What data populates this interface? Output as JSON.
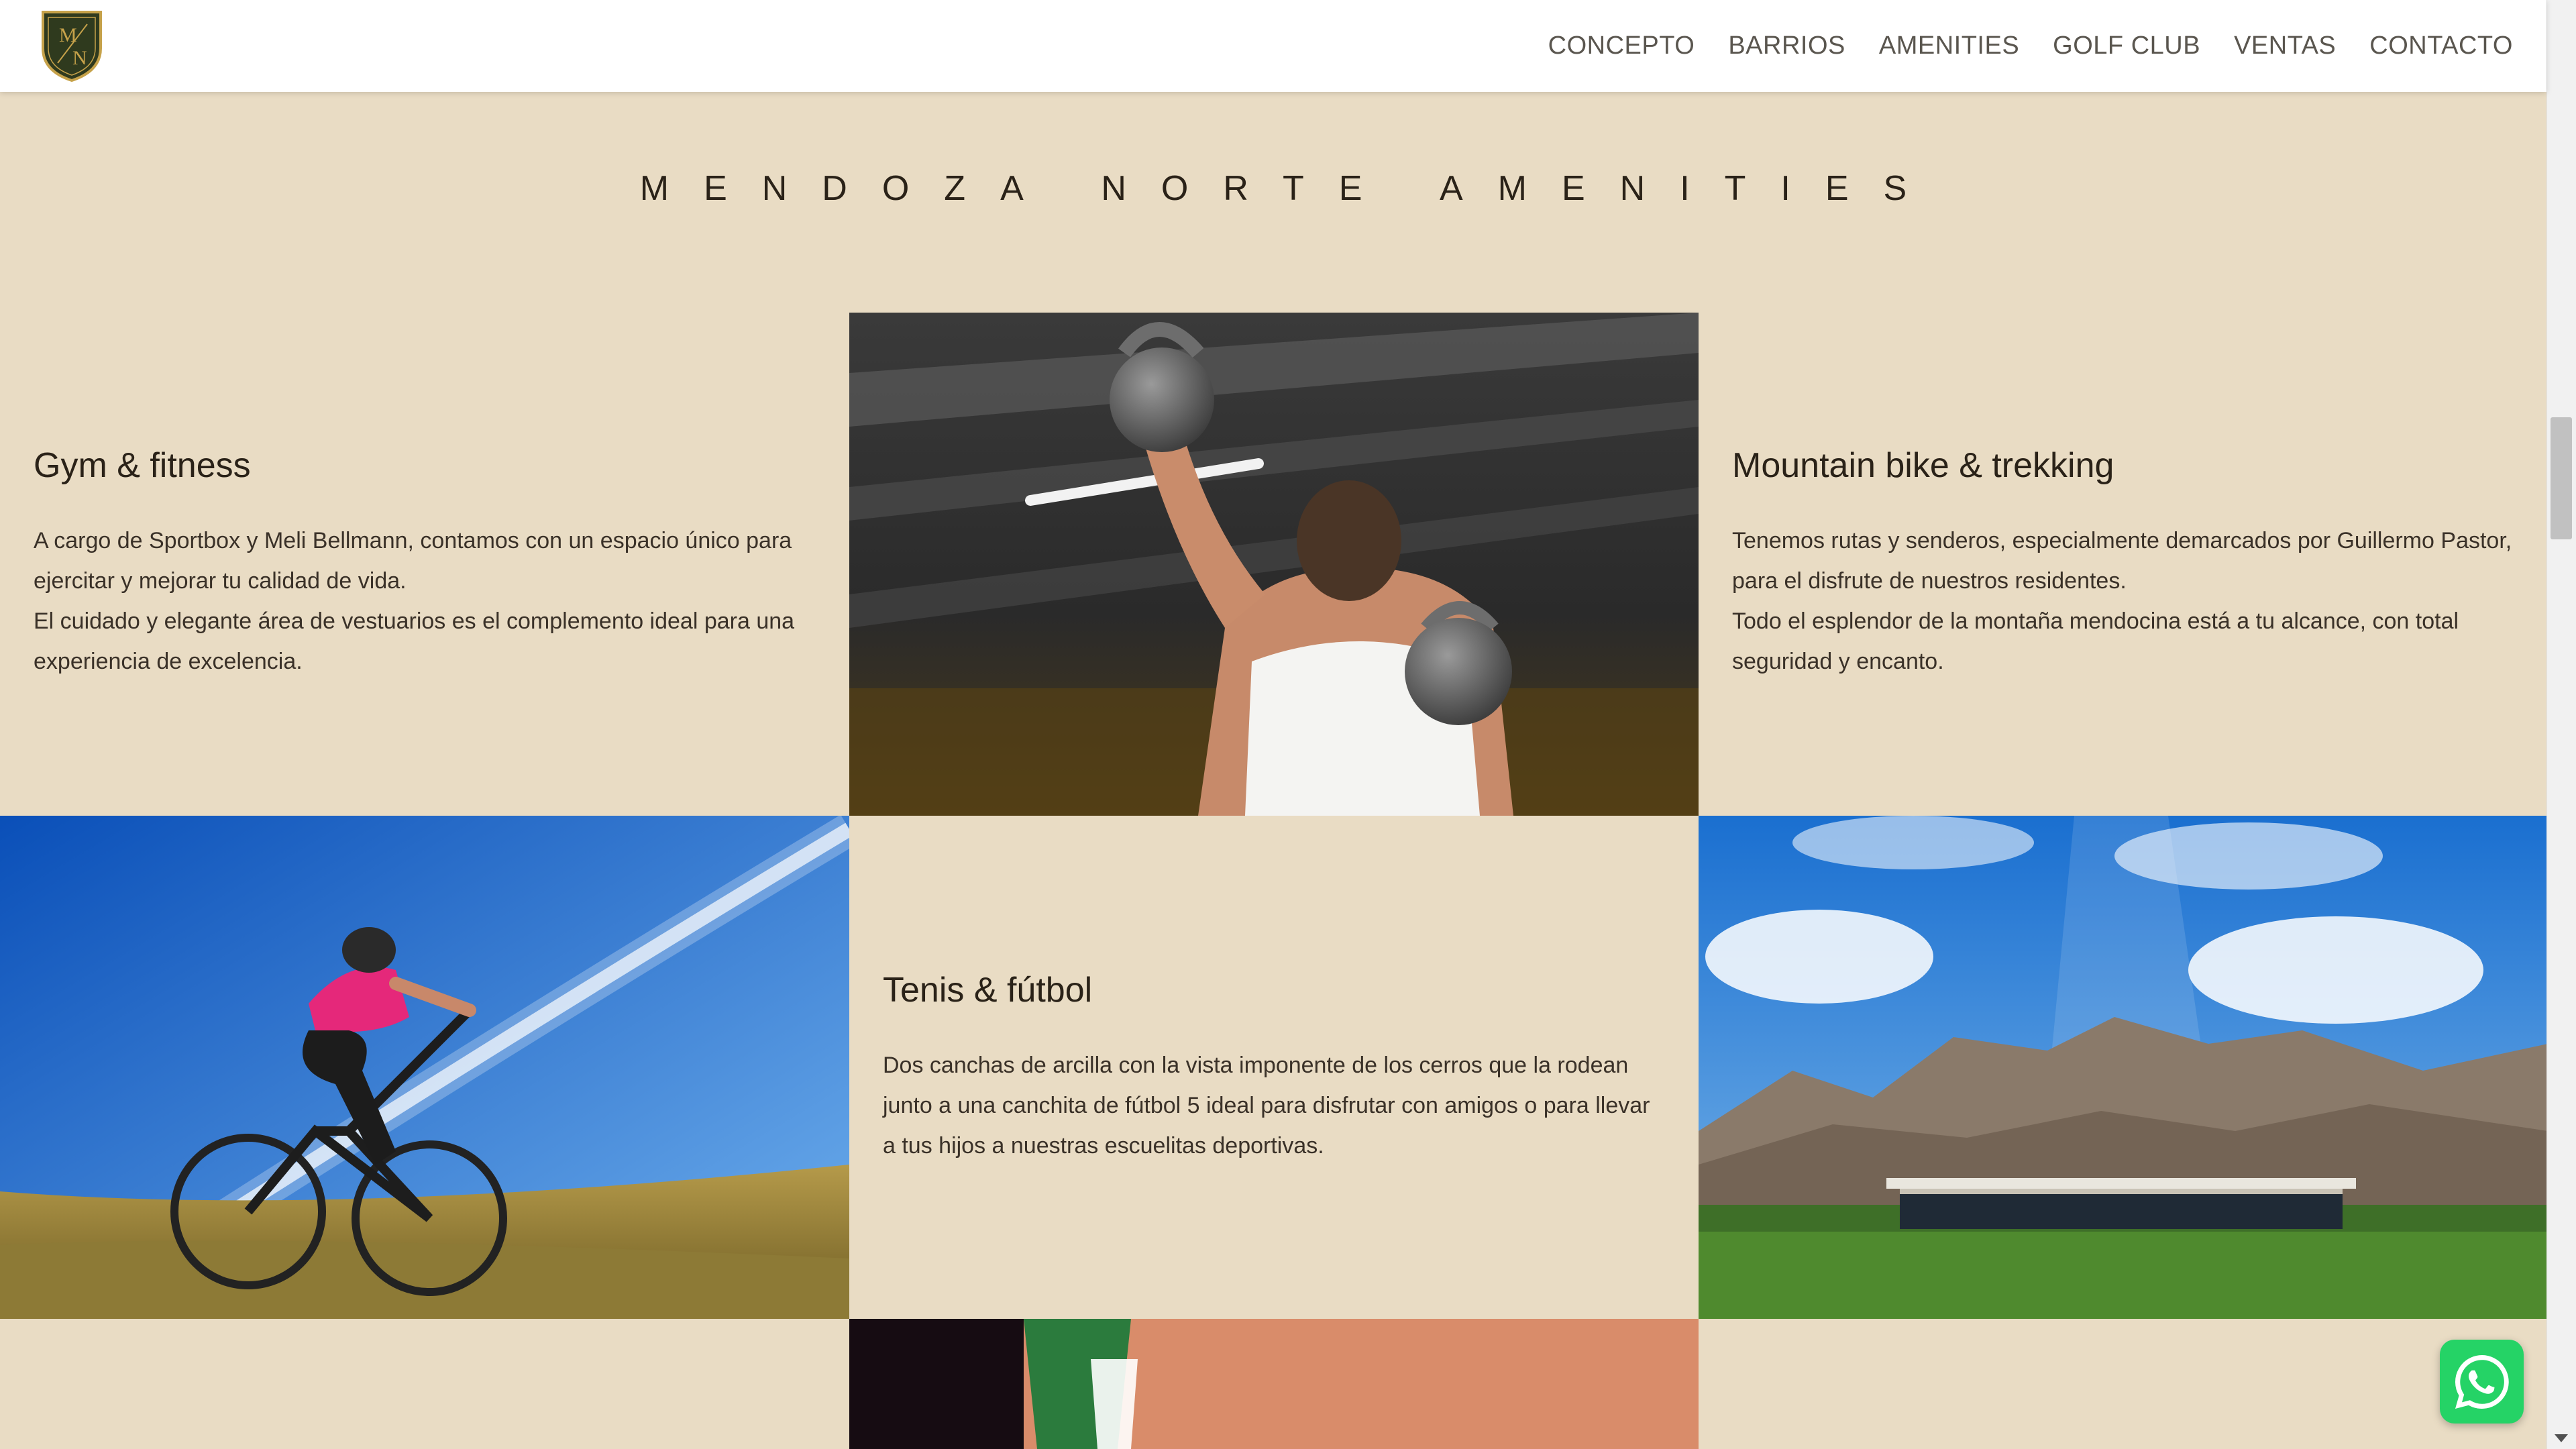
{
  "header": {
    "logo_text": "M N",
    "nav": [
      {
        "label": "CONCEPTO"
      },
      {
        "label": "BARRIOS"
      },
      {
        "label": "AMENITIES"
      },
      {
        "label": "GOLF CLUB"
      },
      {
        "label": "VENTAS"
      },
      {
        "label": "CONTACTO"
      }
    ]
  },
  "section": {
    "title": "MENDOZA NORTE AMENITIES"
  },
  "amenities": {
    "gym": {
      "title": "Gym & fitness",
      "line1": "A cargo de Sportbox y Meli Bellmann, contamos con un espacio único para ejercitar y mejorar tu calidad de vida.",
      "line2": "El cuidado y elegante área de vestuarios es el complemento ideal para una experiencia de excelencia."
    },
    "bike": {
      "title": "Mountain bike & trekking",
      "line1": "Tenemos rutas y senderos, especialmente demarcados por Guillermo Pastor, para el disfrute de nuestros residentes.",
      "line2": "Todo el esplendor de la montaña mendocina está a tu alcance, con total seguridad y encanto."
    },
    "tenis": {
      "title": "Tenis & fútbol",
      "line1": "Dos canchas de arcilla con la vista imponente de los cerros que la rodean junto a una canchita de fútbol 5 ideal para disfrutar con amigos o para llevar a tus hijos a nuestras escuelitas deportivas."
    }
  },
  "icons": {
    "whatsapp": "whatsapp-icon",
    "logo": "shield-logo-icon"
  },
  "colors": {
    "background": "#e9dcc4",
    "header": "#ffffff",
    "text": "#2a2218",
    "whatsapp": "#25d366"
  }
}
